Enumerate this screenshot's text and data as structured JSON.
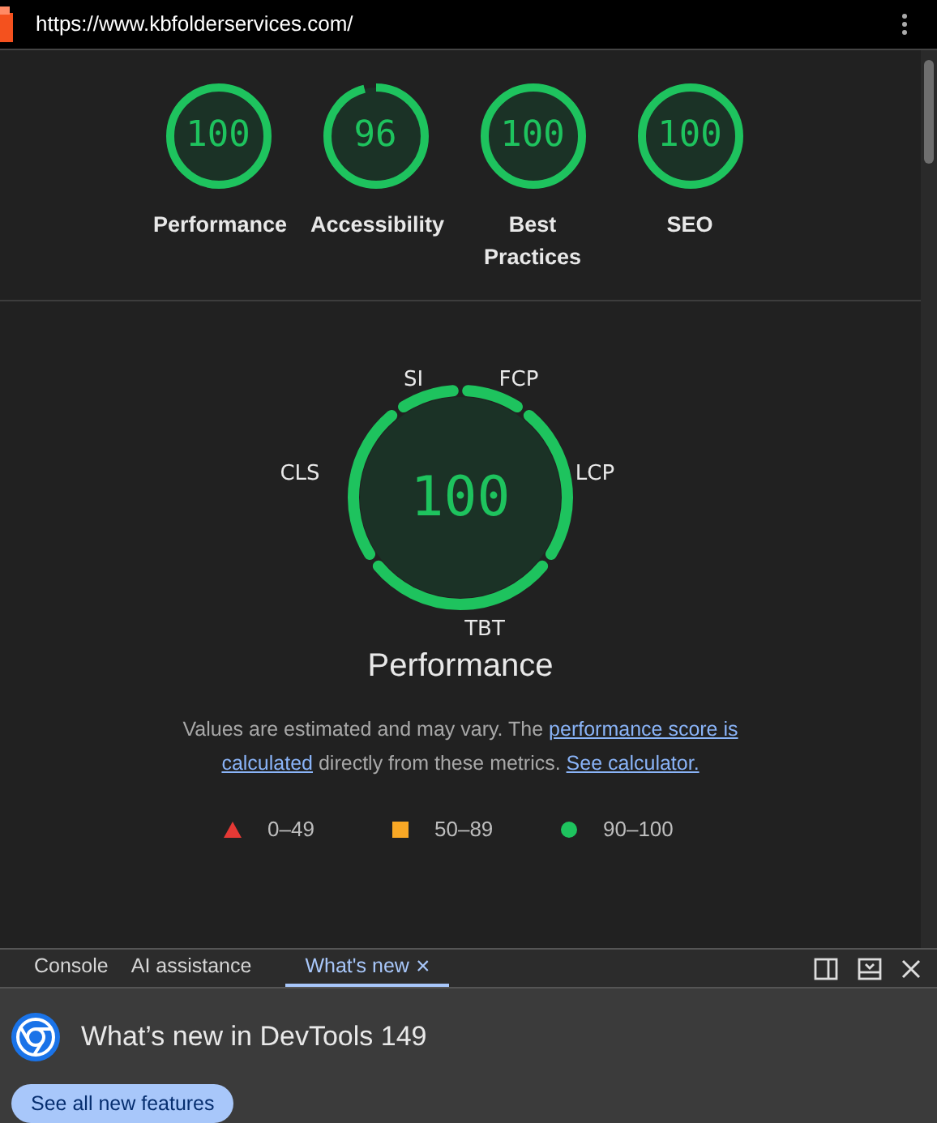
{
  "address_bar": {
    "url": "https://www.kbfolderservices.com/"
  },
  "categories": [
    {
      "score": "100",
      "label": "Performance"
    },
    {
      "score": "96",
      "label": "Accessibility"
    },
    {
      "score": "100",
      "label": "Best Practices"
    },
    {
      "score": "100",
      "label": "SEO"
    }
  ],
  "performance": {
    "score": "100",
    "title": "Performance",
    "metrics": [
      {
        "label": "FCP"
      },
      {
        "label": "LCP"
      },
      {
        "label": "TBT"
      },
      {
        "label": "CLS"
      },
      {
        "label": "SI"
      }
    ],
    "note_parts": [
      {
        "kind": "text",
        "text": "Values are estimated and may vary. The "
      },
      {
        "kind": "link",
        "text": "performance score is"
      },
      {
        "kind": "link",
        "text": "calculated"
      },
      {
        "kind": "text",
        "text": " directly from these metrics. "
      },
      {
        "kind": "link",
        "text": "See calculator."
      }
    ],
    "legend": [
      {
        "kind": "triangle",
        "color": "#e53935",
        "text": "0–49"
      },
      {
        "kind": "square",
        "color": "#f9a825",
        "text": "50–89"
      },
      {
        "kind": "circle",
        "color": "#1ec35e",
        "text": "90–100"
      }
    ]
  },
  "devtools": {
    "tabs": [
      {
        "label": "Console",
        "selected": false,
        "closable": false
      },
      {
        "label": "AI assistance",
        "selected": false,
        "closable": false
      },
      {
        "label": "What's new",
        "selected": true,
        "closable": true
      }
    ],
    "close_tab_glyph": "×",
    "heading": "What’s new in DevTools 149",
    "button": "See all new features"
  }
}
